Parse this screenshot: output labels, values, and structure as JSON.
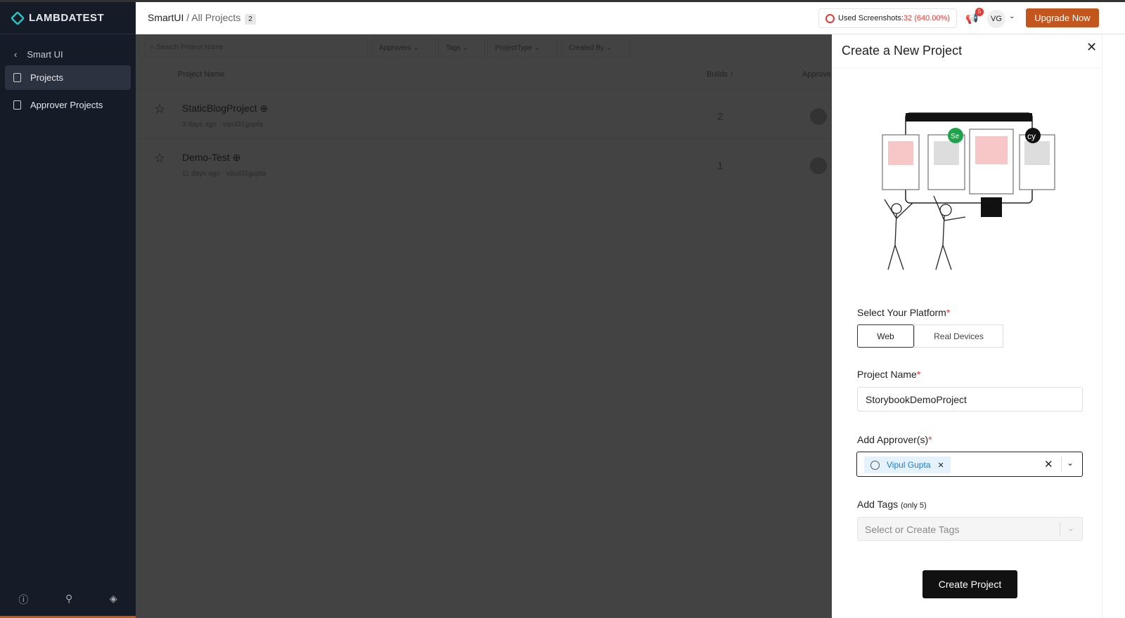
{
  "app": {
    "logo": "LAMBDATEST"
  },
  "sidebar": {
    "back_label": "Smart UI",
    "items": [
      {
        "label": "Projects",
        "active": true
      },
      {
        "label": "Approver Projects",
        "active": false
      }
    ],
    "footer_icons": [
      "help-icon",
      "key-icon",
      "layers-icon"
    ]
  },
  "header": {
    "crumb_root": "SmartUI",
    "crumb_sep": " / ",
    "crumb_current": "All Projects",
    "project_count": "2",
    "usage_label": "Used Screenshots:",
    "usage_value": "32 (640.00%)",
    "notifications": "5",
    "avatar": "VG",
    "upgrade_label": "Upgrade Now"
  },
  "toolbar": {
    "search_placeholder": "Search Project Name",
    "filters": [
      "Approvers",
      "Tags",
      "ProjectType",
      "Created By"
    ]
  },
  "table": {
    "columns": [
      "Project Name",
      "Builds ↑",
      "Approve"
    ],
    "rows": [
      {
        "name": "StaticBlogProject",
        "age": "3 days ago",
        "owner": "vipul31gupta",
        "builds": "2"
      },
      {
        "name": "Demo-Test",
        "age": "11 days ago",
        "owner": "vipul31gupta",
        "builds": "1"
      }
    ]
  },
  "panel": {
    "title": "Create a New Project",
    "platform_label": "Select Your Platform",
    "platforms": [
      "Web",
      "Real Devices"
    ],
    "selected_platform": "Web",
    "name_label": "Project Name",
    "name_value": "StorybookDemoProject",
    "approvers_label": "Add Approver(s)",
    "approvers": [
      "Vipul Gupta"
    ],
    "tags_label": "Add Tags",
    "tags_hint": "(only 5)",
    "tags_placeholder": "Select or Create Tags",
    "create_label": "Create Project",
    "required_mark": "*"
  },
  "colors": {
    "accent": "#c2561c",
    "sidebar": "#161c27",
    "error": "#e53935",
    "chip": "#1c7cd6"
  }
}
